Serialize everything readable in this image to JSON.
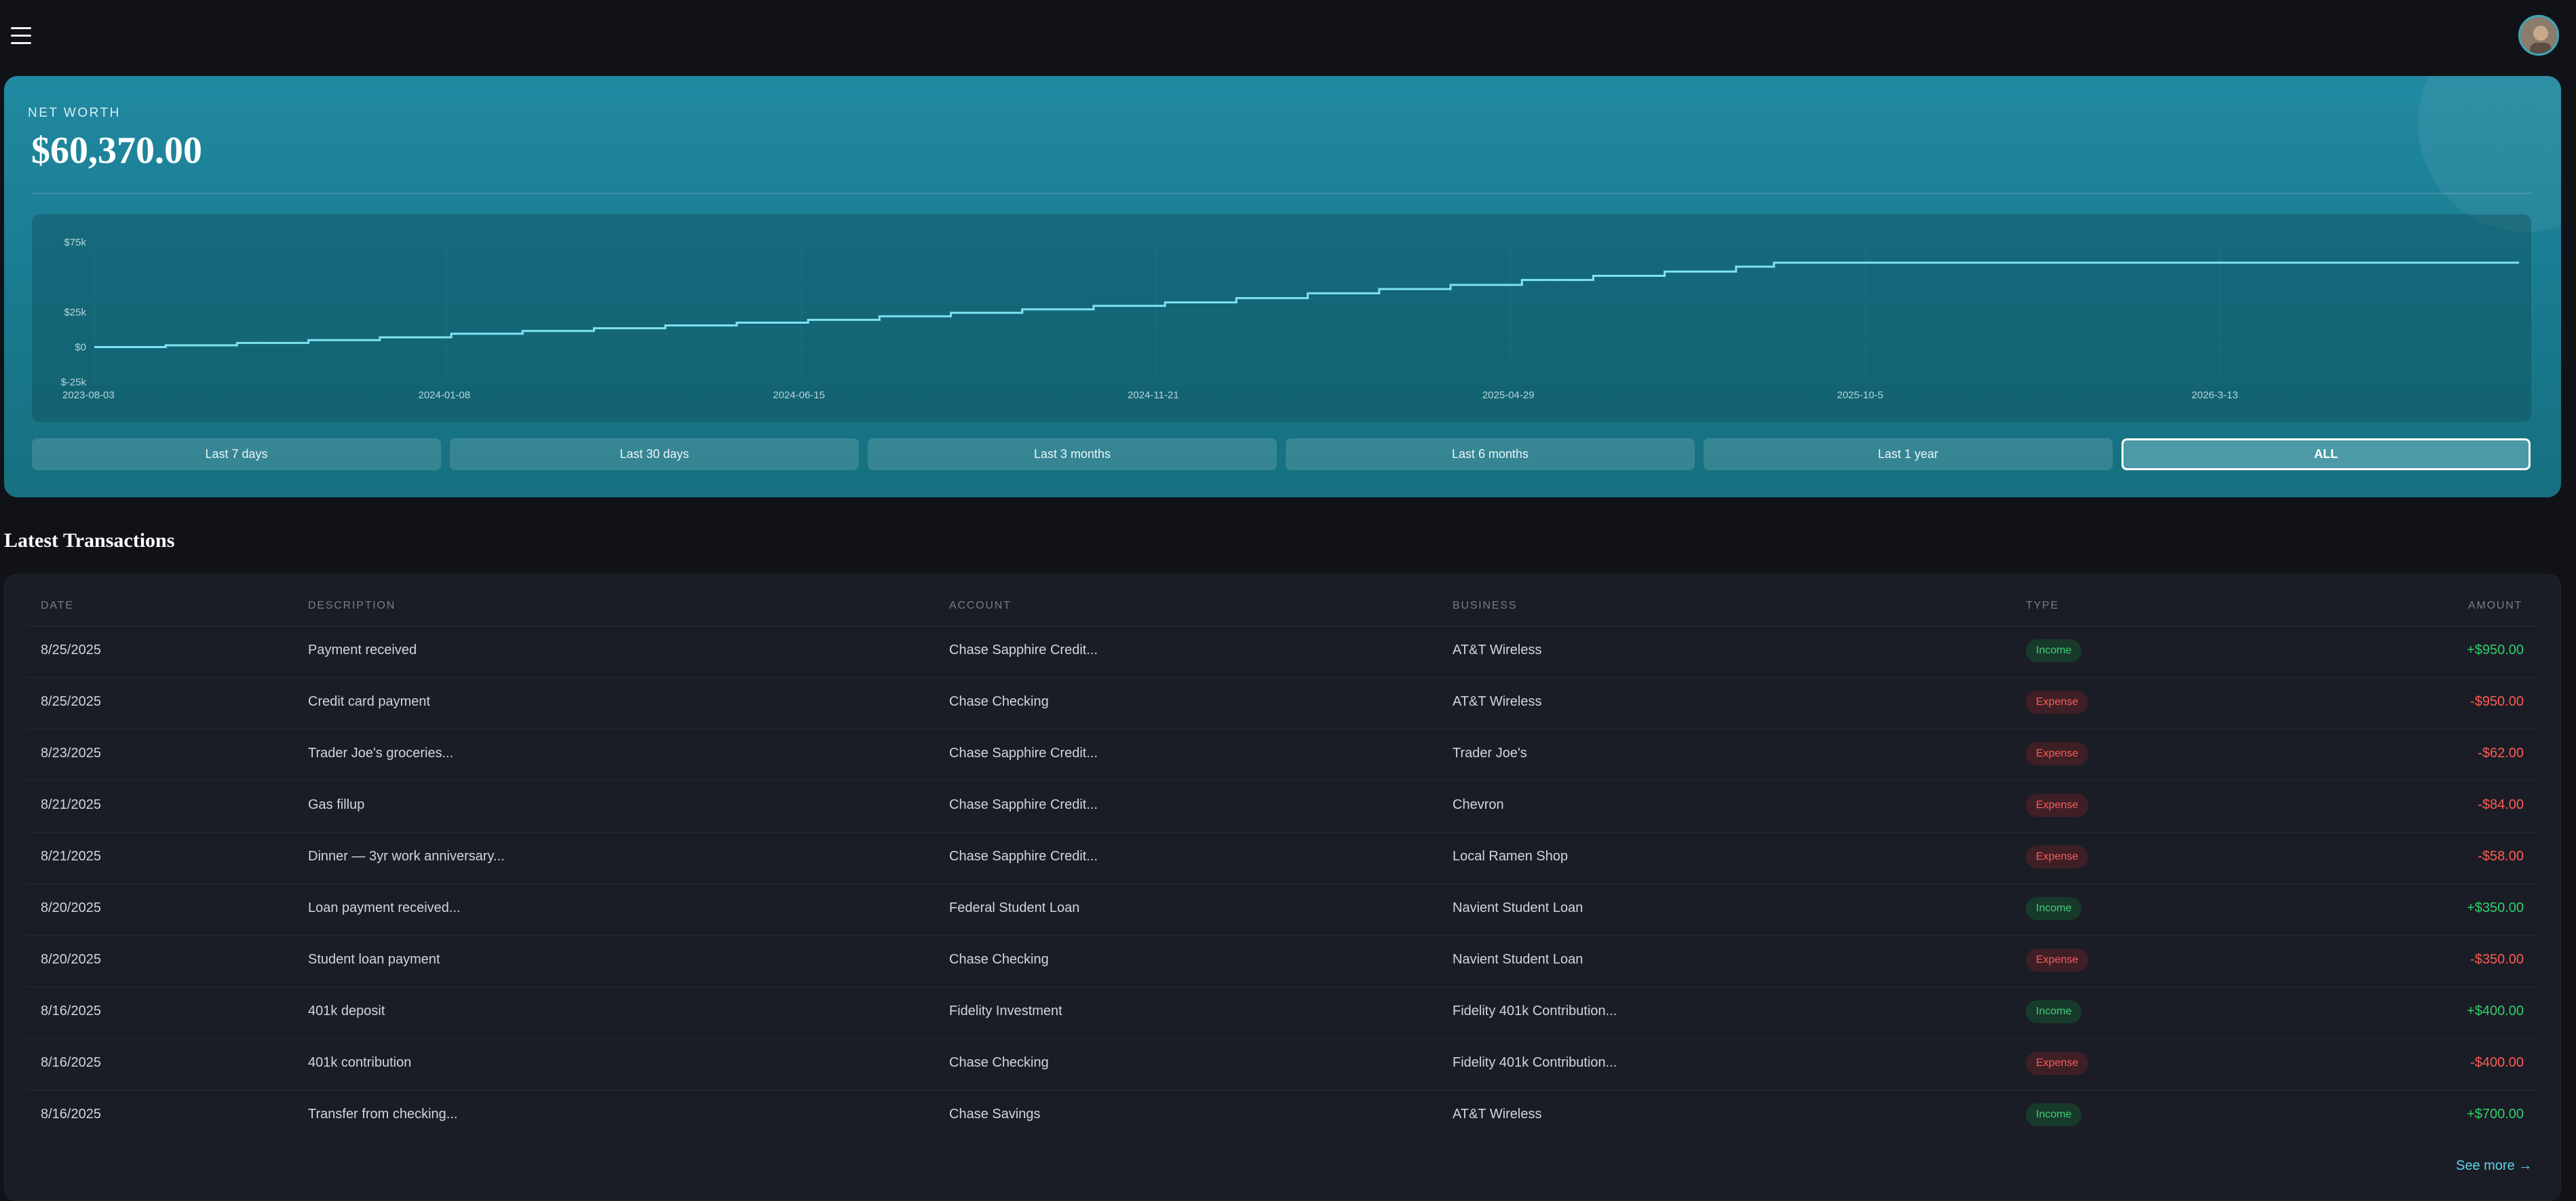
{
  "header": {
    "menu_icon": "hamburger-menu-icon",
    "avatar_icon": "user-avatar"
  },
  "net_worth": {
    "label": "NET WORTH",
    "value": "$60,370.00"
  },
  "chart_data": {
    "type": "line",
    "title": "",
    "xlabel": "",
    "ylabel": "",
    "yticks": [
      {
        "label": "$75k",
        "value": 75000
      },
      {
        "label": "$25k",
        "value": 25000
      },
      {
        "label": "$0",
        "value": 0
      },
      {
        "label": "$-25k",
        "value": -25000
      }
    ],
    "xticks": [
      "2023-08-03",
      "2024-01-08",
      "2024-06-15",
      "2024-11-21",
      "2025-04-29",
      "2025-10-5",
      "2026-3-13"
    ],
    "xlim": [
      "2023-08-03",
      "2026-07-25"
    ],
    "ylim": [
      -25000,
      75000
    ],
    "line_color": "#7fe3f2",
    "series": [
      {
        "x": [
          "2023-08-03",
          "2023-09-04",
          "2023-10-06",
          "2023-11-07",
          "2023-12-09",
          "2024-01-10",
          "2024-02-11",
          "2024-03-14",
          "2024-04-15",
          "2024-05-17",
          "2024-06-18",
          "2024-07-20",
          "2024-08-21",
          "2024-09-22",
          "2024-10-24",
          "2024-11-25",
          "2024-12-27",
          "2025-01-28",
          "2025-03-01",
          "2025-04-02",
          "2025-05-04",
          "2025-06-05",
          "2025-07-07",
          "2025-08-08",
          "2025-08-25",
          "2025-10-05",
          "2025-12-01",
          "2026-02-01",
          "2026-04-01",
          "2026-06-01",
          "2026-07-25"
        ],
        "y": [
          0,
          1300,
          3000,
          5000,
          7000,
          9500,
          11500,
          13500,
          15500,
          17500,
          19500,
          22000,
          24500,
          27000,
          29500,
          32000,
          35000,
          38500,
          41500,
          44500,
          48000,
          51000,
          54000,
          57500,
          60370,
          60370,
          60370,
          60370,
          60370,
          60370,
          60370
        ]
      }
    ],
    "grid": true
  },
  "ranges": [
    {
      "label": "Last 7 days"
    },
    {
      "label": "Last 30 days"
    },
    {
      "label": "Last 3 months"
    },
    {
      "label": "Last 6 months"
    },
    {
      "label": "Last 1 year"
    },
    {
      "label": "ALL"
    }
  ],
  "transactions": {
    "title": "Latest Transactions",
    "columns": {
      "date": "DATE",
      "description": "DESCRIPTION",
      "account": "ACCOUNT",
      "business": "BUSINESS",
      "type": "TYPE",
      "amount": "AMOUNT"
    },
    "rows": [
      {
        "date": "8/25/2025",
        "description": "Payment received",
        "account": "Chase Sapphire Credit...",
        "business": "AT&T Wireless",
        "type": "Income",
        "amount": "+$950.00"
      },
      {
        "date": "8/25/2025",
        "description": "Credit card payment",
        "account": "Chase Checking",
        "business": "AT&T Wireless",
        "type": "Expense",
        "amount": "-$950.00"
      },
      {
        "date": "8/23/2025",
        "description": "Trader Joe's groceries...",
        "account": "Chase Sapphire Credit...",
        "business": "Trader Joe's",
        "type": "Expense",
        "amount": "-$62.00"
      },
      {
        "date": "8/21/2025",
        "description": "Gas fillup",
        "account": "Chase Sapphire Credit...",
        "business": "Chevron",
        "type": "Expense",
        "amount": "-$84.00"
      },
      {
        "date": "8/21/2025",
        "description": "Dinner — 3yr work anniversary...",
        "account": "Chase Sapphire Credit...",
        "business": "Local Ramen Shop",
        "type": "Expense",
        "amount": "-$58.00"
      },
      {
        "date": "8/20/2025",
        "description": "Loan payment received...",
        "account": "Federal Student Loan",
        "business": "Navient Student Loan",
        "type": "Income",
        "amount": "+$350.00"
      },
      {
        "date": "8/20/2025",
        "description": "Student loan payment",
        "account": "Chase Checking",
        "business": "Navient Student Loan",
        "type": "Expense",
        "amount": "-$350.00"
      },
      {
        "date": "8/16/2025",
        "description": "401k deposit",
        "account": "Fidelity Investment",
        "business": "Fidelity 401k Contribution...",
        "type": "Income",
        "amount": "+$400.00"
      },
      {
        "date": "8/16/2025",
        "description": "401k contribution",
        "account": "Chase Checking",
        "business": "Fidelity 401k Contribution...",
        "type": "Expense",
        "amount": "-$400.00"
      },
      {
        "date": "8/16/2025",
        "description": "Transfer from checking...",
        "account": "Chase Savings",
        "business": "AT&T Wireless",
        "type": "Income",
        "amount": "+$700.00"
      }
    ],
    "see_more": "See more →"
  }
}
